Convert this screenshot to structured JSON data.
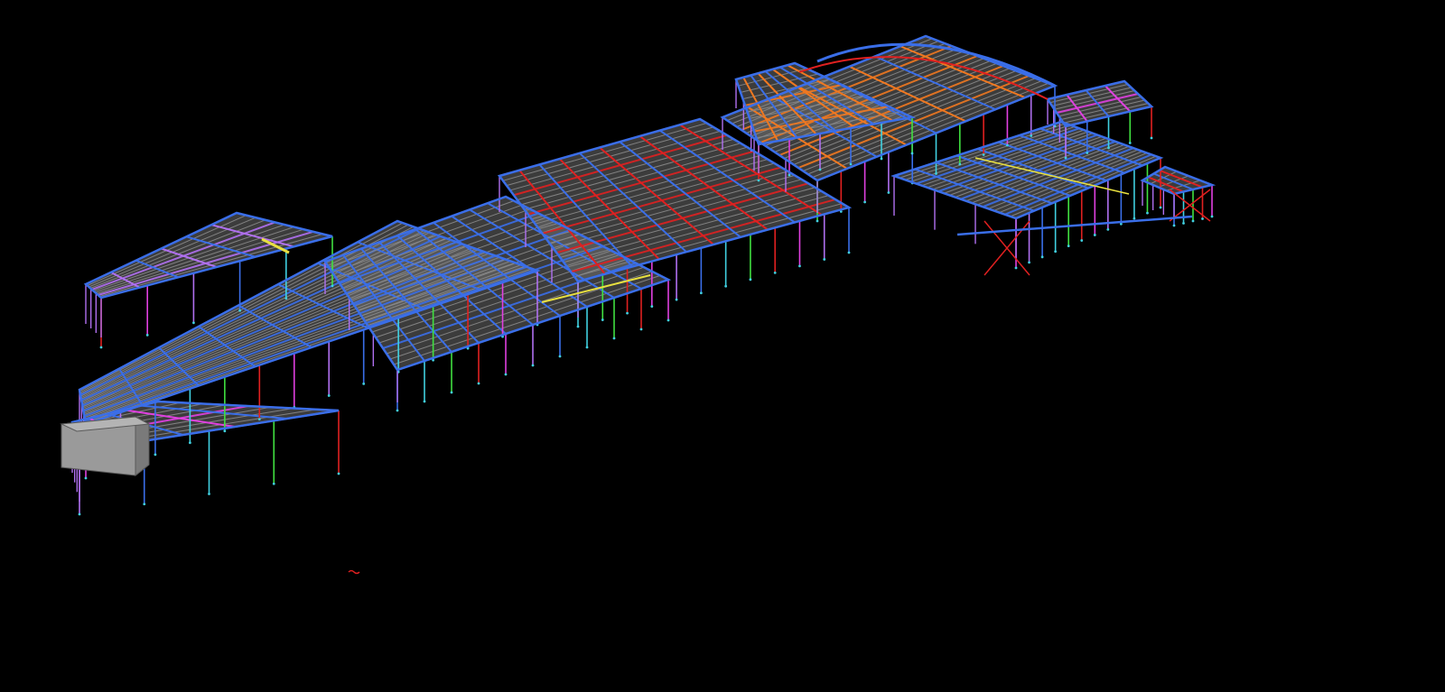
{
  "viewport": {
    "background": "#000000",
    "content": "3d-wireframe-structural-steel-model"
  },
  "palette": {
    "frame_blue": "#3a6ee8",
    "frame_magenta": "#e040e0",
    "frame_red": "#e02020",
    "frame_orange": "#f07820",
    "frame_violet": "#b070f0",
    "frame_green": "#40e040",
    "frame_yellow": "#e8e040",
    "frame_cyan": "#40d0e0",
    "frame_grey": "#8a8a8a",
    "slab_grey": "#6e6e6e",
    "block_grey": "#9a9a9a"
  },
  "icons": {
    "origin_marker": "ucs-origin-icon"
  }
}
